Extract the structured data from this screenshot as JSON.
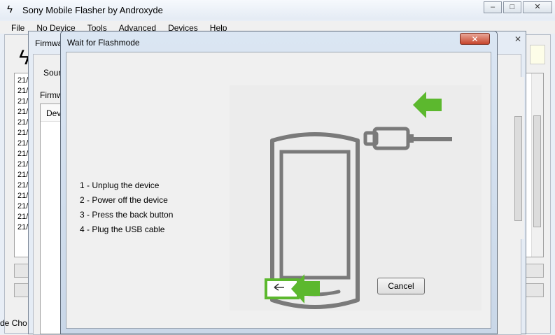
{
  "main_window": {
    "title": "Sony Mobile Flasher by Androxyde",
    "menu": [
      "File",
      "No Device",
      "Tools",
      "Advanced",
      "Devices",
      "Help"
    ],
    "log_prefix": "21/",
    "mode_text": "de Cho"
  },
  "firmware_window": {
    "title": "Firmwa",
    "source_label": "Sour",
    "firmware_label": "Firmw",
    "device_column": "Devi"
  },
  "dialog": {
    "title": "Wait for Flashmode",
    "close_label": "✕",
    "steps": [
      "1 - Unplug the device",
      "2 - Power off the device",
      "3 - Press the back button",
      "4 - Plug the USB cable"
    ],
    "cancel_label": "Cancel"
  },
  "colors": {
    "arrow_green": "#5cb82e",
    "phone_gray": "#7a7a7a"
  },
  "icons": [
    "bolt-icon",
    "usb-cable-icon",
    "back-arrow-icon"
  ]
}
